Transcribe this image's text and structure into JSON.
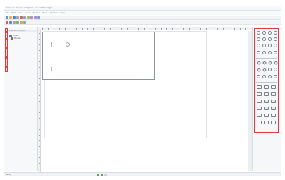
{
  "window": {
    "title": "Business Process Diagram - Visual Paradigm"
  },
  "menu": {
    "items": [
      "File",
      "Edit",
      "View",
      "Insert",
      "Format",
      "Tools",
      "Window",
      "Help"
    ]
  },
  "tree": {
    "header": "Diagram Navigator",
    "items": [
      "Project",
      "Process"
    ]
  },
  "diagram": {
    "lanes": [
      "Lane",
      "Lane"
    ]
  },
  "status_bar": {
    "text": "Ready"
  },
  "colors": {
    "highlight": "#e13b3b",
    "tree_icon": "#3b7de0",
    "status_chip": "#5aa54a"
  }
}
